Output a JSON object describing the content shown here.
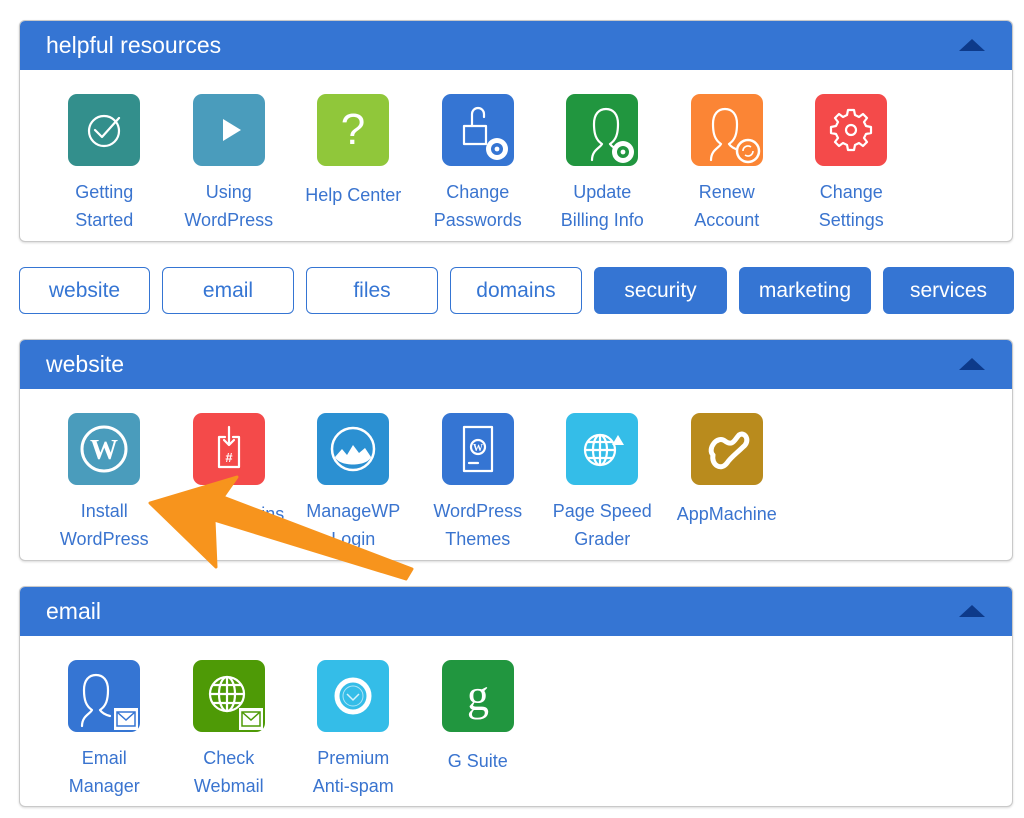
{
  "colors": {
    "header_bg": "#3575d3",
    "caret": "#0d3a8a",
    "link_text": "#3a74cf",
    "annotation_arrow": "#f7941d"
  },
  "helpful": {
    "title": "helpful resources",
    "items": [
      {
        "label": "Getting\nStarted",
        "icon": "checkmark-circle-icon",
        "color": "#338f8c"
      },
      {
        "label": "Using\nWordPress",
        "icon": "play-icon",
        "color": "#4a9cbc"
      },
      {
        "label": "Help Center",
        "icon": "question-mark-icon",
        "color": "#90c73a"
      },
      {
        "label": "Change\nPasswords",
        "icon": "unlock-gear-icon",
        "color": "#3575d3"
      },
      {
        "label": "Update\nBilling Info",
        "icon": "user-gear-icon",
        "color": "#21963f"
      },
      {
        "label": "Renew\nAccount",
        "icon": "user-refresh-icon",
        "color": "#fb8535"
      },
      {
        "label": "Change\nSettings",
        "icon": "gear-icon",
        "color": "#f44a4a"
      }
    ]
  },
  "tabs": [
    {
      "label": "website",
      "style": "outline"
    },
    {
      "label": "email",
      "style": "outline"
    },
    {
      "label": "files",
      "style": "outline"
    },
    {
      "label": "domains",
      "style": "outline"
    },
    {
      "label": "security",
      "style": "filled"
    },
    {
      "label": "marketing",
      "style": "filled"
    },
    {
      "label": "services",
      "style": "filled"
    }
  ],
  "website": {
    "title": "website",
    "items": [
      {
        "label": "Install\nWordPress",
        "icon": "wordpress-icon",
        "color": "#4a9cbc"
      },
      {
        "label": "Install Plugins",
        "icon": "plugin-install-icon",
        "color": "#f44a4a"
      },
      {
        "label": "ManageWP\nLogin",
        "icon": "managewp-icon",
        "color": "#2b90d2"
      },
      {
        "label": "WordPress\nThemes",
        "icon": "wordpress-theme-icon",
        "color": "#3575d3"
      },
      {
        "label": "Page Speed\nGrader",
        "icon": "globe-arrow-icon",
        "color": "#34bde8"
      },
      {
        "label": "AppMachine",
        "icon": "appmachine-icon",
        "color": "#b98b1d"
      }
    ]
  },
  "email": {
    "title": "email",
    "items": [
      {
        "label": "Email\nManager",
        "icon": "user-mail-icon",
        "color": "#3575d3"
      },
      {
        "label": "Check\nWebmail",
        "icon": "globe-mail-icon",
        "color": "#4e9a06"
      },
      {
        "label": "Premium\nAnti-spam",
        "icon": "antispam-icon",
        "color": "#34bde8"
      },
      {
        "label": "G Suite",
        "icon": "g-suite-icon",
        "color": "#21963f"
      }
    ]
  }
}
